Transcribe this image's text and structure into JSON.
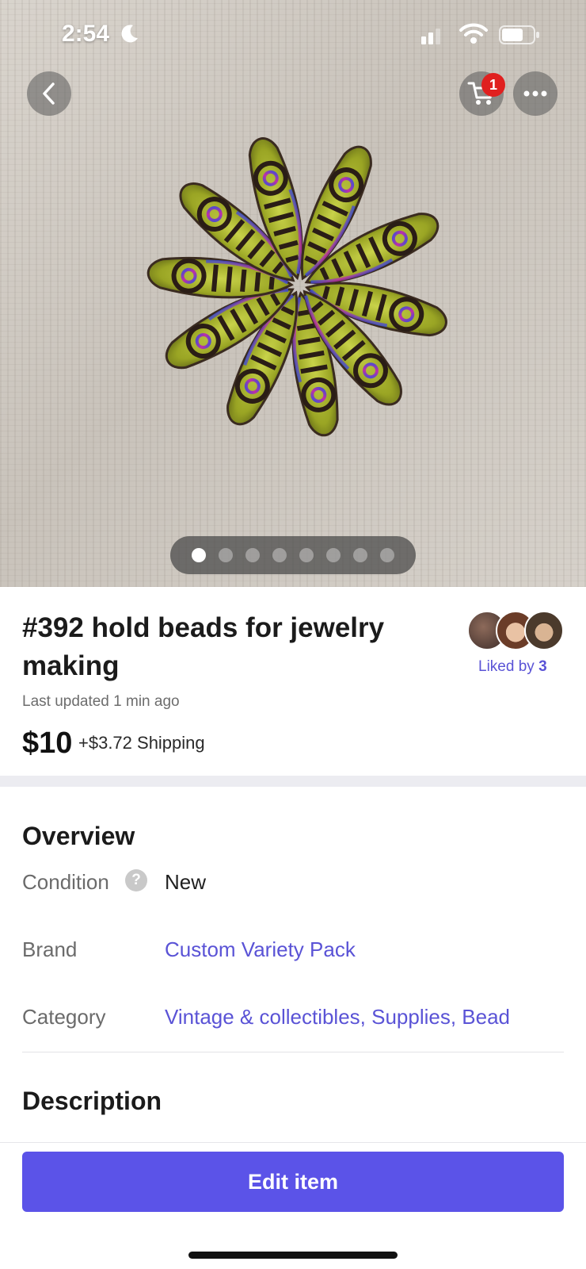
{
  "status_bar": {
    "time": "2:54",
    "icons": [
      "moon-icon",
      "signal-icon",
      "wifi-icon",
      "battery-icon"
    ]
  },
  "header": {
    "back_icon": "chevron-left-icon",
    "cart_icon": "cart-icon",
    "cart_badge": "1",
    "more_icon": "more-horizontal-icon"
  },
  "gallery": {
    "total_images": 8,
    "active_index": 0
  },
  "listing": {
    "title": "#392 hold beads for jewelry making",
    "liked_by_label": "Liked by",
    "liked_by_count": "3",
    "last_updated": "Last updated 1 min ago",
    "price": "$10",
    "shipping": "+$3.72 Shipping"
  },
  "overview": {
    "heading": "Overview",
    "condition_label": "Condition",
    "condition_help_icon": "question-circle-icon",
    "condition_value": "New",
    "brand_label": "Brand",
    "brand_value": "Custom Variety Pack",
    "category_label": "Category",
    "category_value": "Vintage & collectibles, Supplies, Bead"
  },
  "description": {
    "heading": "Description"
  },
  "actions": {
    "edit_label": "Edit item"
  },
  "colors": {
    "accent": "#5b53e8",
    "link": "#5a53d6",
    "badge": "#e0201f",
    "bead_green": "#a8b52a"
  }
}
